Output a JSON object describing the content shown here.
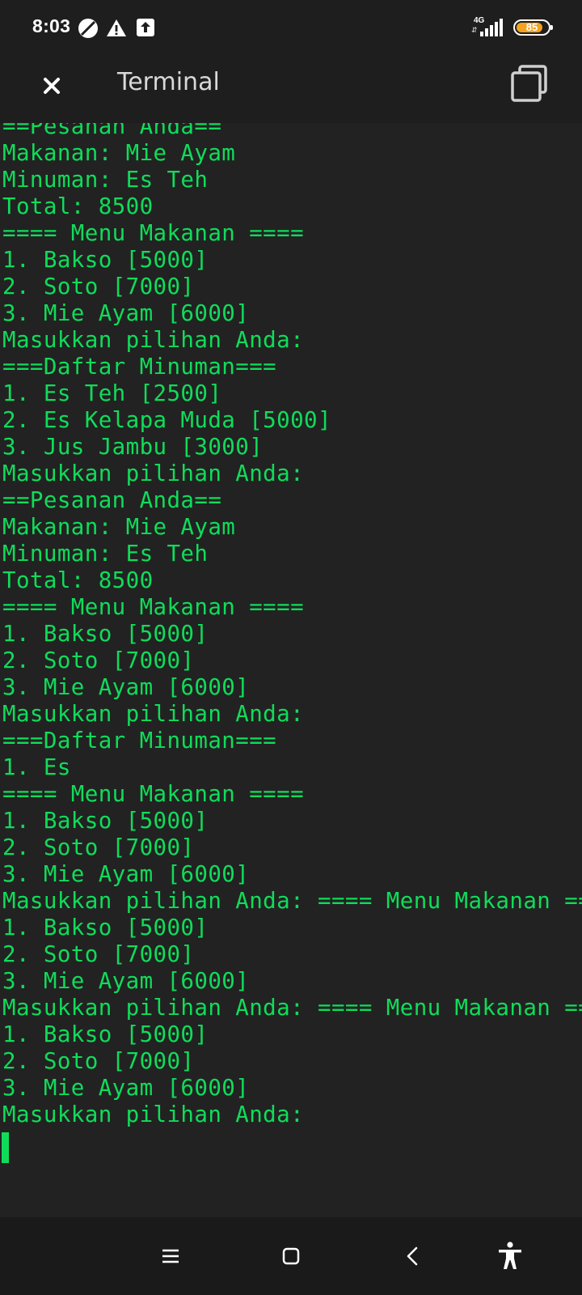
{
  "status_bar": {
    "time": "8:03",
    "network_type": "4G",
    "network_arrows": "⇵",
    "battery_level": "85",
    "battery_fraction": 0.85,
    "icons": [
      "blocked-circle-icon",
      "warning-icon",
      "upload-icon",
      "signal-icon",
      "battery-icon"
    ]
  },
  "app_bar": {
    "title": "Terminal",
    "close_icon": "close-icon",
    "windows_icon": "windows-icon"
  },
  "terminal": {
    "lines": [
      "==Pesanan Anda==",
      "Makanan: Mie Ayam",
      "Minuman: Es Teh",
      "Total: 8500",
      "==== Menu Makanan ====",
      "1. Bakso [5000]",
      "2. Soto [7000]",
      "3. Mie Ayam [6000]",
      "Masukkan pilihan Anda:",
      "===Daftar Minuman===",
      "1. Es Teh [2500]",
      "2. Es Kelapa Muda [5000]",
      "3. Jus Jambu [3000]",
      "Masukkan pilihan Anda:",
      "==Pesanan Anda==",
      "Makanan: Mie Ayam",
      "Minuman: Es Teh",
      "Total: 8500",
      "==== Menu Makanan ====",
      "1. Bakso [5000]",
      "2. Soto [7000]",
      "3. Mie Ayam [6000]",
      "Masukkan pilihan Anda:",
      "===Daftar Minuman===",
      "1. Es",
      "==== Menu Makanan ====",
      "1. Bakso [5000]",
      "2. Soto [7000]",
      "3. Mie Ayam [6000]",
      "Masukkan pilihan Anda: ==== Menu Makanan ====",
      "1. Bakso [5000]",
      "2. Soto [7000]",
      "3. Mie Ayam [6000]",
      "Masukkan pilihan Anda: ==== Menu Makanan ====",
      "1. Bakso [5000]",
      "2. Soto [7000]",
      "3. Mie Ayam [6000]",
      "Masukkan pilihan Anda: "
    ],
    "text_color": "#10dc5a",
    "background": "#222222"
  },
  "nav_bar": {
    "buttons": [
      "menu-icon",
      "home-icon",
      "back-icon",
      "accessibility-icon"
    ]
  }
}
